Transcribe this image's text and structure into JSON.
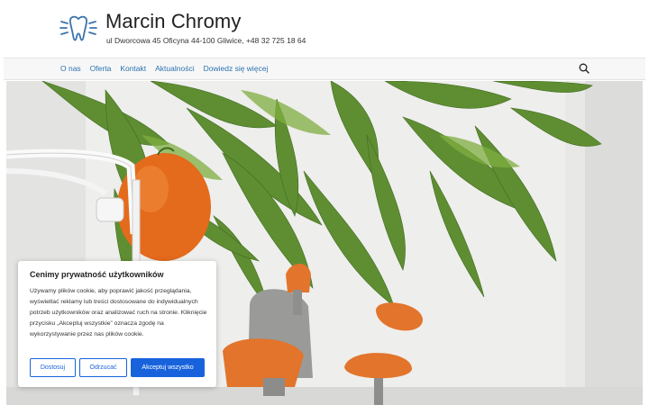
{
  "header": {
    "site_title": "Marcin Chromy",
    "site_description": "ul Dworcowa 45 Oficyna 44-100 Gliwice, +48 32 725 18 64",
    "logo_icon": "tooth-icon",
    "logo_color": "#3a73ad"
  },
  "nav": {
    "items": [
      {
        "label": "O nas"
      },
      {
        "label": "Oferta"
      },
      {
        "label": "Kontakt"
      },
      {
        "label": "Aktualności"
      },
      {
        "label": "Dowiedz się więcej"
      }
    ],
    "search_icon": "search-icon",
    "link_color": "#2a72b0"
  },
  "hero": {
    "image": "dental-office-photo"
  },
  "cookie_banner": {
    "title": "Cenimy prywatność użytkowników",
    "text": "Używamy plików cookie, aby poprawić jakość przeglądania, wyświetlać reklamy lub treści dostosowane do indywidualnych potrzeb użytkowników oraz analizować ruch na stronie. Kliknięcie przycisku „Akceptuj wszystkie” oznacza zgodę na wykorzystywanie przez nas plików cookie.",
    "customize_label": "Dostosuj",
    "reject_label": "Odrzucać",
    "accept_label": "Akceptuj wszystko",
    "accent_color": "#1863dc"
  }
}
